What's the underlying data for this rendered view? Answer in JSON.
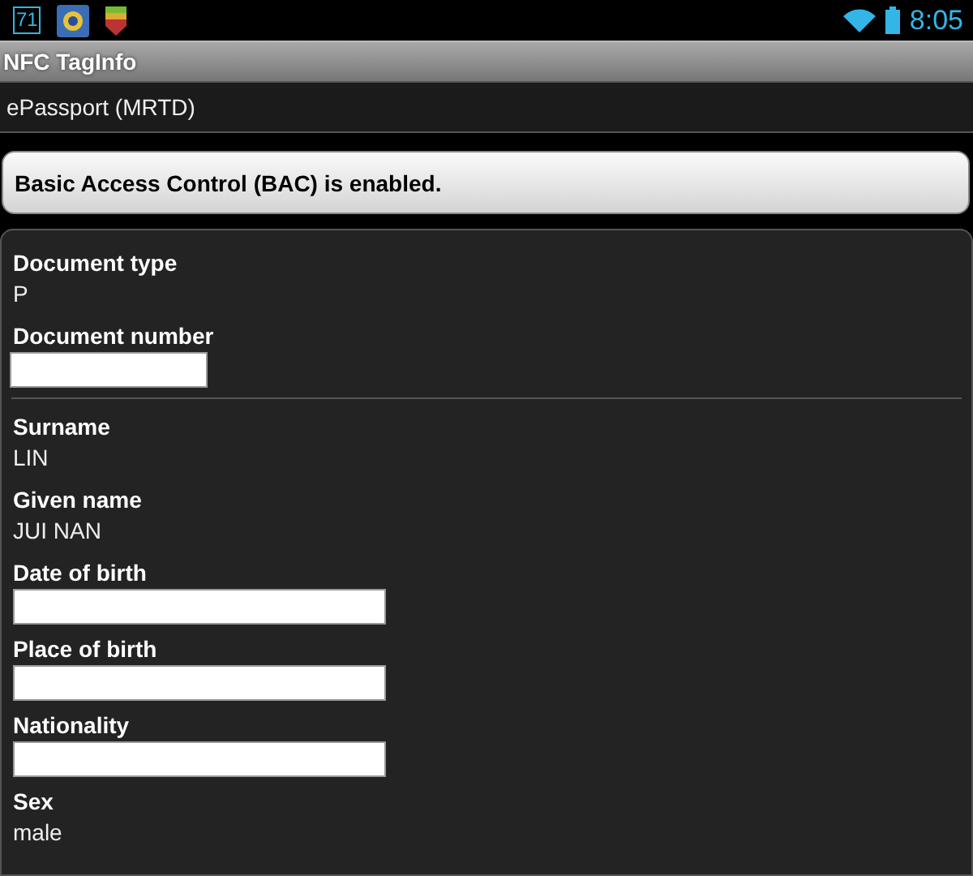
{
  "status_bar": {
    "notification_badge": "71",
    "time": "8:05"
  },
  "app_bar": {
    "title": "NFC TagInfo"
  },
  "header": {
    "title": "ePassport (MRTD)"
  },
  "message": {
    "text": "Basic Access Control (BAC) is enabled."
  },
  "sections": [
    {
      "fields": [
        {
          "label": "Document type",
          "kind": "text",
          "value": "P"
        },
        {
          "label": "Document number",
          "kind": "redacted"
        }
      ]
    },
    {
      "fields": [
        {
          "label": "Surname",
          "kind": "text",
          "value": "LIN"
        },
        {
          "label": "Given name",
          "kind": "text",
          "value": "JUI NAN"
        },
        {
          "label": "Date of birth",
          "kind": "redacted"
        },
        {
          "label": "Place of birth",
          "kind": "redacted"
        },
        {
          "label": "Nationality",
          "kind": "redacted"
        },
        {
          "label": "Sex",
          "kind": "text",
          "value": "male"
        }
      ]
    }
  ]
}
